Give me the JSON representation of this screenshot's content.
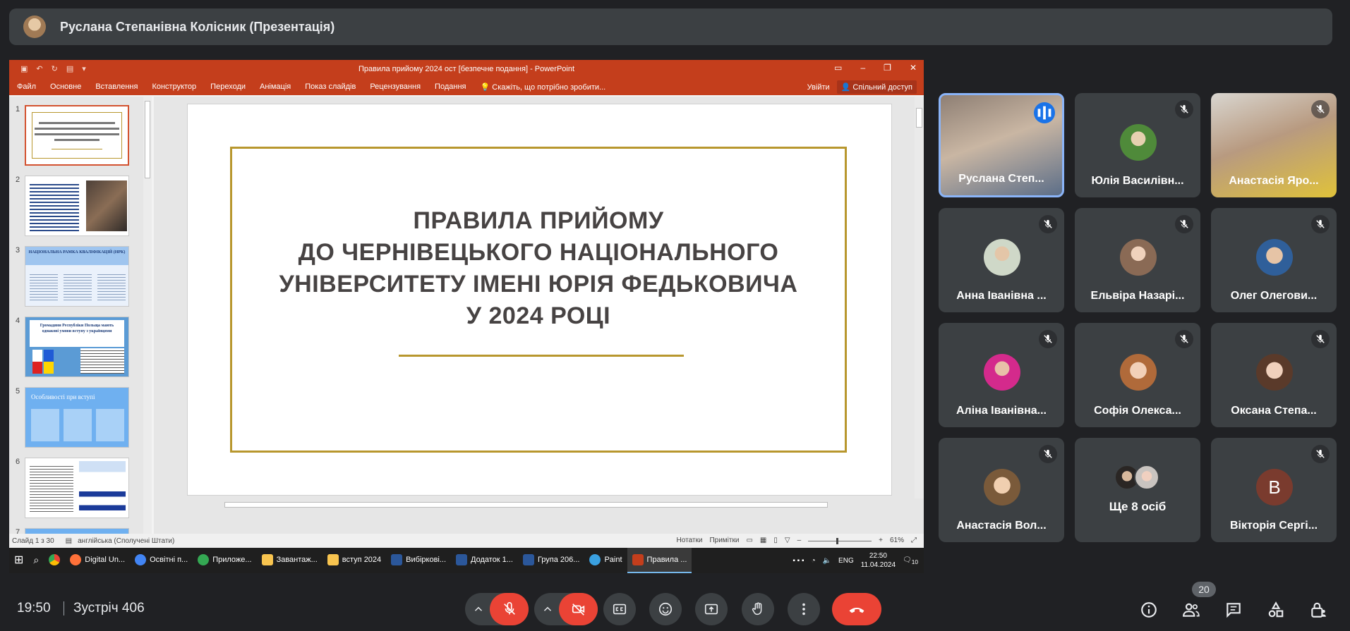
{
  "presenter": {
    "name": "Руслана Степанівна Колісник (Презентація)"
  },
  "powerpoint": {
    "window_title": "Правила прийому 2024 ост [безпечне подання] - PowerPoint",
    "ribbon_tabs": [
      "Файл",
      "Основне",
      "Вставлення",
      "Конструктор",
      "Переходи",
      "Анімація",
      "Показ слайдів",
      "Рецензування",
      "Подання"
    ],
    "tell_me": "Скажіть, що потрібно зробити...",
    "sign_in": "Увійти",
    "share": "Спільний доступ",
    "slide_numbers": [
      "1",
      "2",
      "3",
      "4",
      "5",
      "6",
      "7"
    ],
    "slide": {
      "title_lines": [
        "ПРАВИЛА ПРИЙОМУ",
        "ДО ЧЕРНІВЕЦЬКОГО НАЦІОНАЛЬНОГО",
        "УНІВЕРСИТЕТУ ІМЕНІ ЮРІЯ ФЕДЬКОВИЧА",
        "У 2024 РОЦІ"
      ]
    },
    "thumb_texts": {
      "t3": "НАЦІОНАЛЬНА РАМКА КВАЛІФІКАЦІЙ (НРК)",
      "t4": "Громадяни Республіки Польща мають однакові умови вступу з українцями",
      "t5": "Особливості при вступі"
    },
    "status": {
      "slide_of": "Слайд 1 з 30",
      "language": "англійська (Сполучені Штати)",
      "notes": "Нотатки",
      "comments": "Примітки",
      "zoom": "61%"
    }
  },
  "taskbar": {
    "items": [
      {
        "label": "Digital Un...",
        "color": "#ff7139"
      },
      {
        "label": "Освітні п...",
        "color": "#4285f4"
      },
      {
        "label": "Приложе...",
        "color": "#34a853"
      },
      {
        "label": "Завантаж...",
        "color": "#f8c44f"
      },
      {
        "label": "вступ 2024",
        "color": "#f8c44f"
      },
      {
        "label": "Вибіркові...",
        "color": "#2b579a"
      },
      {
        "label": "Додаток 1...",
        "color": "#2b579a"
      },
      {
        "label": "Група 206...",
        "color": "#2b579a"
      },
      {
        "label": "Paint",
        "color": "#3aa0e0"
      },
      {
        "label": "Правила ...",
        "color": "#c43e1c"
      }
    ],
    "lang": "ENG",
    "time": "22:50",
    "date": "11.04.2024",
    "notif_count": "10"
  },
  "participants": [
    {
      "name": "Руслана Степ...",
      "speaking": true
    },
    {
      "name": "Юлія Василівн..."
    },
    {
      "name": "Анастасія Яро..."
    },
    {
      "name": "Анна Іванівна ..."
    },
    {
      "name": "Ельвіра Назарі..."
    },
    {
      "name": "Олег Олегови..."
    },
    {
      "name": "Аліна Іванівна..."
    },
    {
      "name": "Софія Олекса..."
    },
    {
      "name": "Оксана Степа..."
    },
    {
      "name": "Анастасія Вол..."
    },
    {
      "name": "Ще 8 осіб"
    },
    {
      "name": "Вікторія Сергі...",
      "initial": "В"
    }
  ],
  "meeting": {
    "time": "19:50",
    "name": "Зустріч 406",
    "participant_count": "20"
  },
  "colors": {
    "background": "#202124",
    "tile": "#3c4043",
    "accent": "#8ab4f8",
    "danger": "#ea4335",
    "ppt": "#c43e1c",
    "gold": "#b8972e"
  }
}
